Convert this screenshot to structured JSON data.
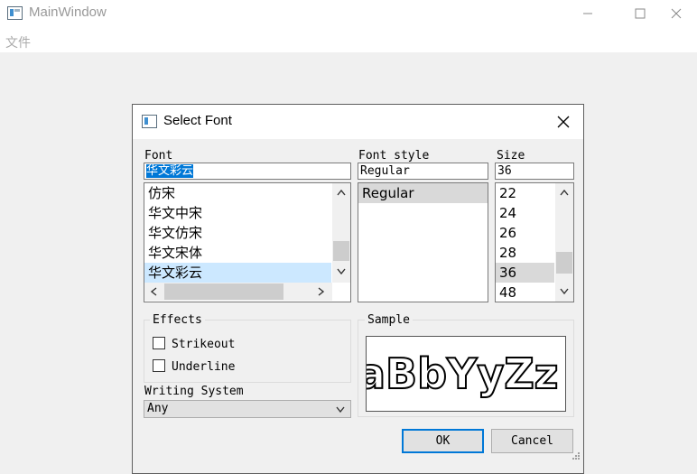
{
  "window": {
    "title": "MainWindow"
  },
  "menubar": {
    "file": "文件"
  },
  "dialog": {
    "title": "Select Font",
    "font": {
      "label": "Font",
      "value": "华文彩云",
      "items": [
        "仿宋",
        "华文中宋",
        "华文仿宋",
        "华文宋体",
        "华文彩云"
      ],
      "selected_index": 4
    },
    "style": {
      "label": "Font style",
      "value": "Regular",
      "items": [
        "Regular"
      ],
      "selected_index": 0
    },
    "size": {
      "label": "Size",
      "value": "36",
      "items": [
        "22",
        "24",
        "26",
        "28",
        "36",
        "48"
      ],
      "selected_index": 4
    },
    "effects": {
      "title": "Effects",
      "strikeout": "Strikeout",
      "underline": "Underline",
      "strikeout_checked": false,
      "underline_checked": false
    },
    "sample": {
      "title": "Sample",
      "text": "aBbYyZz"
    },
    "writing_system": {
      "label": "Writing System",
      "value": "Any"
    },
    "buttons": {
      "ok": "OK",
      "cancel": "Cancel"
    }
  },
  "colors": {
    "selection": "#cce8ff",
    "accent": "#0078d7",
    "list_selected_gray": "#d9d9d9"
  }
}
